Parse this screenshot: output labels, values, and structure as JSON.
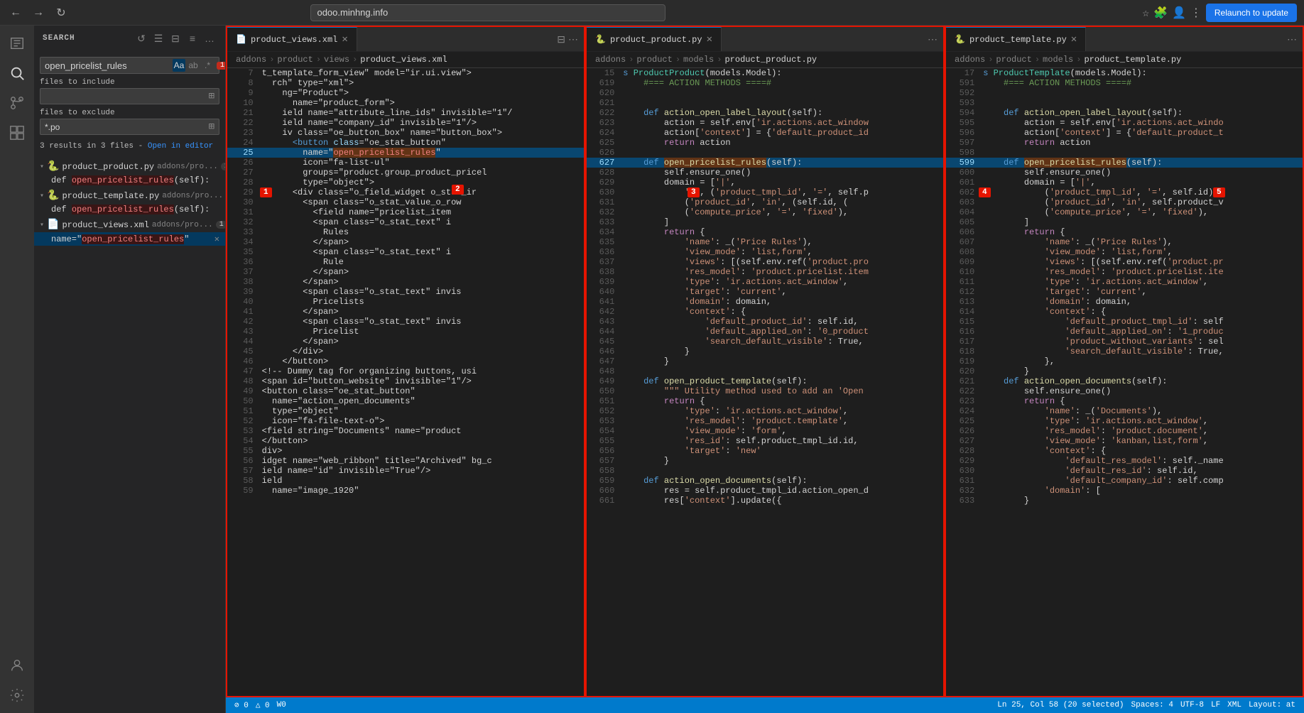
{
  "browser": {
    "back_label": "←",
    "forward_label": "→",
    "refresh_label": "↻",
    "url": "odoo.minhng.info",
    "relaunch_label": "Relaunch to update"
  },
  "search": {
    "title": "SEARCH",
    "query": "open_pricelist_rules",
    "files_to_include_label": "files to include",
    "files_to_exclude_label": "files to exclude",
    "files_to_exclude_value": "*.po",
    "results_summary": "3 results in 3 files",
    "open_in_editor": "Open in editor",
    "results": [
      {
        "file": "product_product.py",
        "path": "addons/pro...",
        "count": 1,
        "matches": [
          {
            "line": "",
            "text": "def open_pricelist_rules(self):"
          }
        ]
      },
      {
        "file": "product_template.py",
        "path": "addons/pro...",
        "count": 1,
        "matches": [
          {
            "line": "",
            "text": "def open_pricelist_rules(self):"
          }
        ]
      },
      {
        "file": "product_views.xml",
        "path": "addons/pro...",
        "count": 1,
        "matches": [
          {
            "line": "",
            "text": "name=\"open_pricelist_rules\"",
            "has_close": true
          }
        ]
      }
    ]
  },
  "editor1": {
    "tab_name": "product_views.xml",
    "tab_icon": "📄",
    "breadcrumb": "addons > product > views > product_views.xml",
    "lines": [
      {
        "num": 7,
        "content": "t_template_form_view\" model=\"ir.ui.view\">"
      },
      {
        "num": 8,
        "content": "  rch\" type=\"xml\">"
      },
      {
        "num": 9,
        "content": "    ng=\"Product\">"
      },
      {
        "num": 10,
        "content": "      name=\"product_form\">"
      },
      {
        "num": 21,
        "content": "    ield name=\"attribute_line_ids\" invisible=\"1\"/"
      },
      {
        "num": 22,
        "content": "    ield name=\"company_id\" invisible=\"1\"/>"
      },
      {
        "num": 23,
        "content": "    iv class=\"oe_button_box\" name=\"button_box\">"
      },
      {
        "num": 24,
        "content": "      <button class=\"oe_stat_button\""
      },
      {
        "num": 25,
        "content": "        name=\"open_pricelist_rules\""
      },
      {
        "num": 26,
        "content": "        icon=\"fa-list-ul\""
      },
      {
        "num": 27,
        "content": "        groups=\"product.group_product_pricel"
      },
      {
        "num": 28,
        "content": "        type=\"object\">"
      },
      {
        "num": 29,
        "content": "      <div class=\"o_field_widget o_stat_ir"
      },
      {
        "num": 30,
        "content": "        <span class=\"o_stat_value_o_row"
      },
      {
        "num": 31,
        "content": "          <field name=\"pricelist_item"
      },
      {
        "num": 32,
        "content": "          <span class=\"o_stat_text\" i"
      },
      {
        "num": 33,
        "content": "            Rules"
      },
      {
        "num": 34,
        "content": "          </span>"
      },
      {
        "num": 35,
        "content": "          <span class=\"o_stat_text\" i"
      },
      {
        "num": 36,
        "content": "            Rule"
      },
      {
        "num": 37,
        "content": "          </span>"
      },
      {
        "num": 38,
        "content": "        </span>"
      },
      {
        "num": 39,
        "content": "        <span class=\"o_stat_text\" invis"
      },
      {
        "num": 40,
        "content": "          Pricelists"
      },
      {
        "num": 41,
        "content": "        </span>"
      },
      {
        "num": 42,
        "content": "        <span class=\"o_stat_text\" invis"
      },
      {
        "num": 43,
        "content": "          Pricelist"
      },
      {
        "num": 44,
        "content": "        </span>"
      },
      {
        "num": 45,
        "content": "      </div>"
      },
      {
        "num": 46,
        "content": "    </button>"
      },
      {
        "num": 47,
        "content": "    <!-- Dummy tag for organizing buttons, usi"
      },
      {
        "num": 48,
        "content": "    <span id=\"button_website\" invisible=\"1\"/>"
      },
      {
        "num": 49,
        "content": "    <button class=\"oe_stat_button\""
      },
      {
        "num": 50,
        "content": "      name=\"action_open_documents\""
      },
      {
        "num": 51,
        "content": "      type=\"object\""
      },
      {
        "num": 52,
        "content": "      icon=\"fa-file-text-o\">"
      },
      {
        "num": 53,
        "content": "    <field string=\"Documents\" name=\"product"
      },
      {
        "num": 54,
        "content": "    </button>"
      },
      {
        "num": 55,
        "content": "  div>"
      },
      {
        "num": 56,
        "content": "  idget name=\"web_ribbon\" title=\"Archived\" bg_c"
      },
      {
        "num": 57,
        "content": "  ield name=\"id\" invisible=\"True\"/>"
      },
      {
        "num": 58,
        "content": "  ield"
      },
      {
        "num": 59,
        "content": "    name=\"image_1920\""
      }
    ]
  },
  "editor2": {
    "tab_name": "product_product.py",
    "tab_icon": "🐍",
    "breadcrumb": "addons > product > models > product_product.py",
    "lines": [
      {
        "num": 15,
        "content": "s ProductProduct(models.Model):"
      },
      {
        "num": 619,
        "content": "    #=== ACTION METHODS ====#"
      },
      {
        "num": 620,
        "content": ""
      },
      {
        "num": 621,
        "content": ""
      },
      {
        "num": 622,
        "content": "    def action_open_label_layout(self):"
      },
      {
        "num": 623,
        "content": "        action = self.env['ir.actions.act_window"
      },
      {
        "num": 624,
        "content": "        action['context'] = {'default_product_id"
      },
      {
        "num": 625,
        "content": "        return action"
      },
      {
        "num": 626,
        "content": ""
      },
      {
        "num": 627,
        "content": "    def open_pricelist_rules(self):"
      },
      {
        "num": 628,
        "content": "        self.ensure_one()"
      },
      {
        "num": 629,
        "content": "        domain = ['|',"
      },
      {
        "num": 630,
        "content": "            '&', ('product_tmpl_id', '=', self.p"
      },
      {
        "num": 631,
        "content": "            ('product_id', 'in', (self.id, ("
      },
      {
        "num": 632,
        "content": "            ('compute_price', '=', 'fixed'),"
      },
      {
        "num": 633,
        "content": "        ]"
      },
      {
        "num": 634,
        "content": "        return {"
      },
      {
        "num": 635,
        "content": "            'name': _('Price Rules'),"
      },
      {
        "num": 636,
        "content": "            'view_mode': 'list,form',"
      },
      {
        "num": 637,
        "content": "            'views': [(self.env.ref('product.pro"
      },
      {
        "num": 638,
        "content": "            'res_model': 'product.pricelist.item"
      },
      {
        "num": 639,
        "content": "            'type': 'ir.actions.act_window',"
      },
      {
        "num": 640,
        "content": "            'target': 'current',"
      },
      {
        "num": 641,
        "content": "            'domain': domain,"
      },
      {
        "num": 642,
        "content": "            'context': {"
      },
      {
        "num": 643,
        "content": "                'default_product_id': self.id,"
      },
      {
        "num": 644,
        "content": "                'default_applied_on': '0_product"
      },
      {
        "num": 645,
        "content": "                'search_default_visible': True,"
      },
      {
        "num": 646,
        "content": "            }"
      },
      {
        "num": 647,
        "content": "        }"
      },
      {
        "num": 648,
        "content": ""
      },
      {
        "num": 649,
        "content": "    def open_product_template(self):"
      },
      {
        "num": 650,
        "content": "        \"\"\" Utility method used to add an 'Open"
      },
      {
        "num": 651,
        "content": "        return {"
      },
      {
        "num": 652,
        "content": "            'type': 'ir.actions.act_window',"
      },
      {
        "num": 653,
        "content": "            'res_model': 'product.template',"
      },
      {
        "num": 654,
        "content": "            'view_mode': 'form',"
      },
      {
        "num": 655,
        "content": "            'res_id': self.product_tmpl_id.id,"
      },
      {
        "num": 656,
        "content": "            'target': 'new'"
      },
      {
        "num": 657,
        "content": "        }"
      },
      {
        "num": 658,
        "content": ""
      },
      {
        "num": 659,
        "content": "    def action_open_documents(self):"
      },
      {
        "num": 660,
        "content": "        res = self.product_tmpl_id.action_open_d"
      },
      {
        "num": 661,
        "content": "        res['context'].update({"
      }
    ]
  },
  "editor3": {
    "tab_name": "product_template.py",
    "tab_icon": "🐍",
    "breadcrumb": "addons > product > models > product_template.py",
    "lines": [
      {
        "num": 17,
        "content": "s ProductTemplate(models.Model):"
      },
      {
        "num": 591,
        "content": "    #=== ACTION METHODS ====#"
      },
      {
        "num": 592,
        "content": ""
      },
      {
        "num": 593,
        "content": ""
      },
      {
        "num": 594,
        "content": "    def action_open_label_layout(self):"
      },
      {
        "num": 595,
        "content": "        action = self.env['ir.actions.act_windo"
      },
      {
        "num": 596,
        "content": "        action['context'] = {'default_product_t"
      },
      {
        "num": 597,
        "content": "        return action"
      },
      {
        "num": 598,
        "content": ""
      },
      {
        "num": 599,
        "content": "    def open_pricelist_rules(self):"
      },
      {
        "num": 600,
        "content": "        self.ensure_one()"
      },
      {
        "num": 601,
        "content": "        domain = ['|',"
      },
      {
        "num": 602,
        "content": "            ('product_tmpl_id', '=', self.id),"
      },
      {
        "num": 603,
        "content": "            ('product_id', 'in', self.product_v"
      },
      {
        "num": 604,
        "content": "            ('compute_price', '=', 'fixed'),"
      },
      {
        "num": 605,
        "content": "        ]"
      },
      {
        "num": 606,
        "content": "        return {"
      },
      {
        "num": 607,
        "content": "            'name': _('Price Rules'),"
      },
      {
        "num": 608,
        "content": "            'view_mode': 'list,form',"
      },
      {
        "num": 609,
        "content": "            'views': [(self.env.ref('product.pr"
      },
      {
        "num": 610,
        "content": "            'res_model': 'product.pricelist.ite"
      },
      {
        "num": 611,
        "content": "            'type': 'ir.actions.act_window',"
      },
      {
        "num": 612,
        "content": "            'target': 'current',"
      },
      {
        "num": 613,
        "content": "            'domain': domain,"
      },
      {
        "num": 614,
        "content": "            'context': {"
      },
      {
        "num": 615,
        "content": "                'default_product_tmpl_id': self"
      },
      {
        "num": 616,
        "content": "                'default_applied_on': '1_produc"
      },
      {
        "num": 617,
        "content": "                'product_without_variants': sel"
      },
      {
        "num": 618,
        "content": "                'search_default_visible': True,"
      },
      {
        "num": 619,
        "content": "            },"
      },
      {
        "num": 620,
        "content": "        }"
      },
      {
        "num": 621,
        "content": "    def action_open_documents(self):"
      },
      {
        "num": 622,
        "content": "        self.ensure_one()"
      },
      {
        "num": 623,
        "content": "        return {"
      },
      {
        "num": 624,
        "content": "            'name': _('Documents'),"
      },
      {
        "num": 625,
        "content": "            'type': 'ir.actions.act_window',"
      },
      {
        "num": 626,
        "content": "            'res_model': 'product.document',"
      },
      {
        "num": 627,
        "content": "            'view_mode': 'kanban,list,form',"
      },
      {
        "num": 628,
        "content": "            'context': {"
      },
      {
        "num": 629,
        "content": "                'default_res_model': self._name"
      },
      {
        "num": 630,
        "content": "                'default_res_id': self.id,"
      },
      {
        "num": 631,
        "content": "                'default_company_id': self.comp"
      },
      {
        "num": 632,
        "content": "            'domain': ["
      },
      {
        "num": 633,
        "content": "        }"
      }
    ]
  },
  "statusbar": {
    "errors": "⊘ 0",
    "warnings": "△ 0",
    "branch": "W0",
    "line_col": "Ln 25, Col 58 (20 selected)",
    "spaces": "Spaces: 4",
    "encoding": "UTF-8",
    "line_ending": "LF",
    "language": "XML",
    "layout": "Layout: at"
  },
  "markers": {
    "m1": "1",
    "m2": "2",
    "m3": "3",
    "m4": "4",
    "m5": "5"
  }
}
